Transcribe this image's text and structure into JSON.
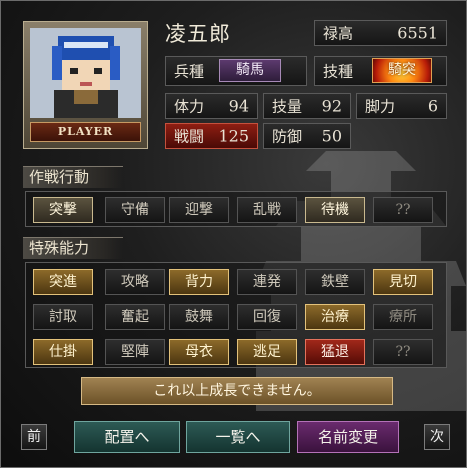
{
  "character": {
    "name": "凌五郎",
    "portrait_tag": "PLAYER",
    "salary_label": "禄高",
    "salary": "6551",
    "troop_label": "兵種",
    "troop": "騎馬",
    "tech_label": "技種",
    "tech": "騎突"
  },
  "stats": [
    {
      "label": "体力",
      "value": "94"
    },
    {
      "label": "技量",
      "value": "92"
    },
    {
      "label": "脚力",
      "value": "6"
    },
    {
      "label": "戦闘",
      "value": "125"
    },
    {
      "label": "防御",
      "value": "50"
    }
  ],
  "tactics": {
    "title": "作戦行動",
    "items": [
      {
        "label": "突撃",
        "state": "on"
      },
      {
        "label": "守備",
        "state": "normal"
      },
      {
        "label": "迎撃",
        "state": "normal"
      },
      {
        "label": "乱戦",
        "state": "normal"
      },
      {
        "label": "待機",
        "state": "on"
      },
      {
        "label": "??",
        "state": "dim"
      }
    ]
  },
  "abilities": {
    "title": "特殊能力",
    "rows": [
      [
        {
          "label": "突進",
          "state": "gold"
        },
        {
          "label": "攻略",
          "state": "normal"
        },
        {
          "label": "背力",
          "state": "gold"
        },
        {
          "label": "連発",
          "state": "normal"
        },
        {
          "label": "鉄壁",
          "state": "normal"
        },
        {
          "label": "見切",
          "state": "gold"
        }
      ],
      [
        {
          "label": "討取",
          "state": "normal"
        },
        {
          "label": "奮起",
          "state": "normal"
        },
        {
          "label": "鼓舞",
          "state": "normal"
        },
        {
          "label": "回復",
          "state": "normal"
        },
        {
          "label": "治療",
          "state": "gold"
        },
        {
          "label": "療所",
          "state": "dim"
        }
      ],
      [
        {
          "label": "仕掛",
          "state": "gold"
        },
        {
          "label": "堅陣",
          "state": "normal"
        },
        {
          "label": "母衣",
          "state": "gold"
        },
        {
          "label": "逃足",
          "state": "gold"
        },
        {
          "label": "猛退",
          "state": "red"
        },
        {
          "label": "??",
          "state": "dim"
        }
      ]
    ]
  },
  "message": "これ以上成長できません。",
  "nav": {
    "prev": "前",
    "deploy": "配置へ",
    "list": "一覧へ",
    "rename": "名前変更",
    "next": "次"
  }
}
